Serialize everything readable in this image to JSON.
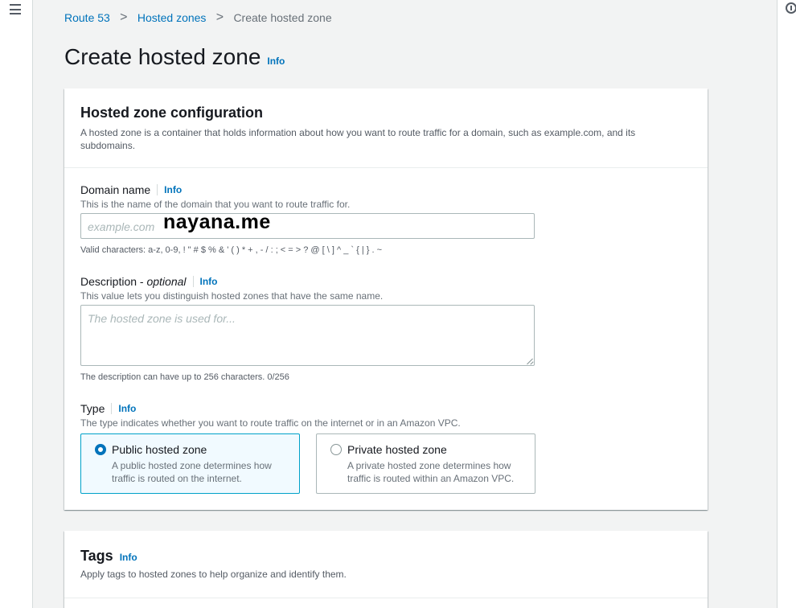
{
  "breadcrumb": {
    "items": [
      "Route 53",
      "Hosted zones"
    ],
    "current": "Create hosted zone",
    "separator": ">"
  },
  "page": {
    "title": "Create hosted zone",
    "info": "Info"
  },
  "config": {
    "title": "Hosted zone configuration",
    "description": "A hosted zone is a container that holds information about how you want to route traffic for a domain, such as example.com, and its subdomains."
  },
  "domain": {
    "label": "Domain name",
    "info": "Info",
    "description": "This is the name of the domain that you want to route traffic for.",
    "placeholder": "example.com",
    "value": "nayana.me",
    "hint": "Valid characters: a-z, 0-9, ! \" # $ % & ' ( ) * + , - / : ; < = > ? @ [ \\ ] ^ _ ` { | } . ~"
  },
  "description_field": {
    "label": "Description - ",
    "label_optional": "optional",
    "info": "Info",
    "description": "This value lets you distinguish hosted zones that have the same name.",
    "placeholder": "The hosted zone is used for...",
    "hint": "The description can have up to 256 characters. 0/256"
  },
  "type": {
    "label": "Type",
    "info": "Info",
    "description": "The type indicates whether you want to route traffic on the internet or in an Amazon VPC.",
    "options": [
      {
        "title": "Public hosted zone",
        "description": "A public hosted zone determines how traffic is routed on the internet.",
        "selected": true
      },
      {
        "title": "Private hosted zone",
        "description": "A private hosted zone determines how traffic is routed within an Amazon VPC.",
        "selected": false
      }
    ]
  },
  "tags": {
    "title": "Tags",
    "info": "Info",
    "description": "Apply tags to hosted zones to help organize and identify them."
  },
  "icons": {
    "menu": "hamburger-menu-icon",
    "help": "help-panel-icon"
  },
  "colors": {
    "link": "#0073bb",
    "selected_border": "#00a1c9",
    "selected_bg": "#f1faff"
  }
}
